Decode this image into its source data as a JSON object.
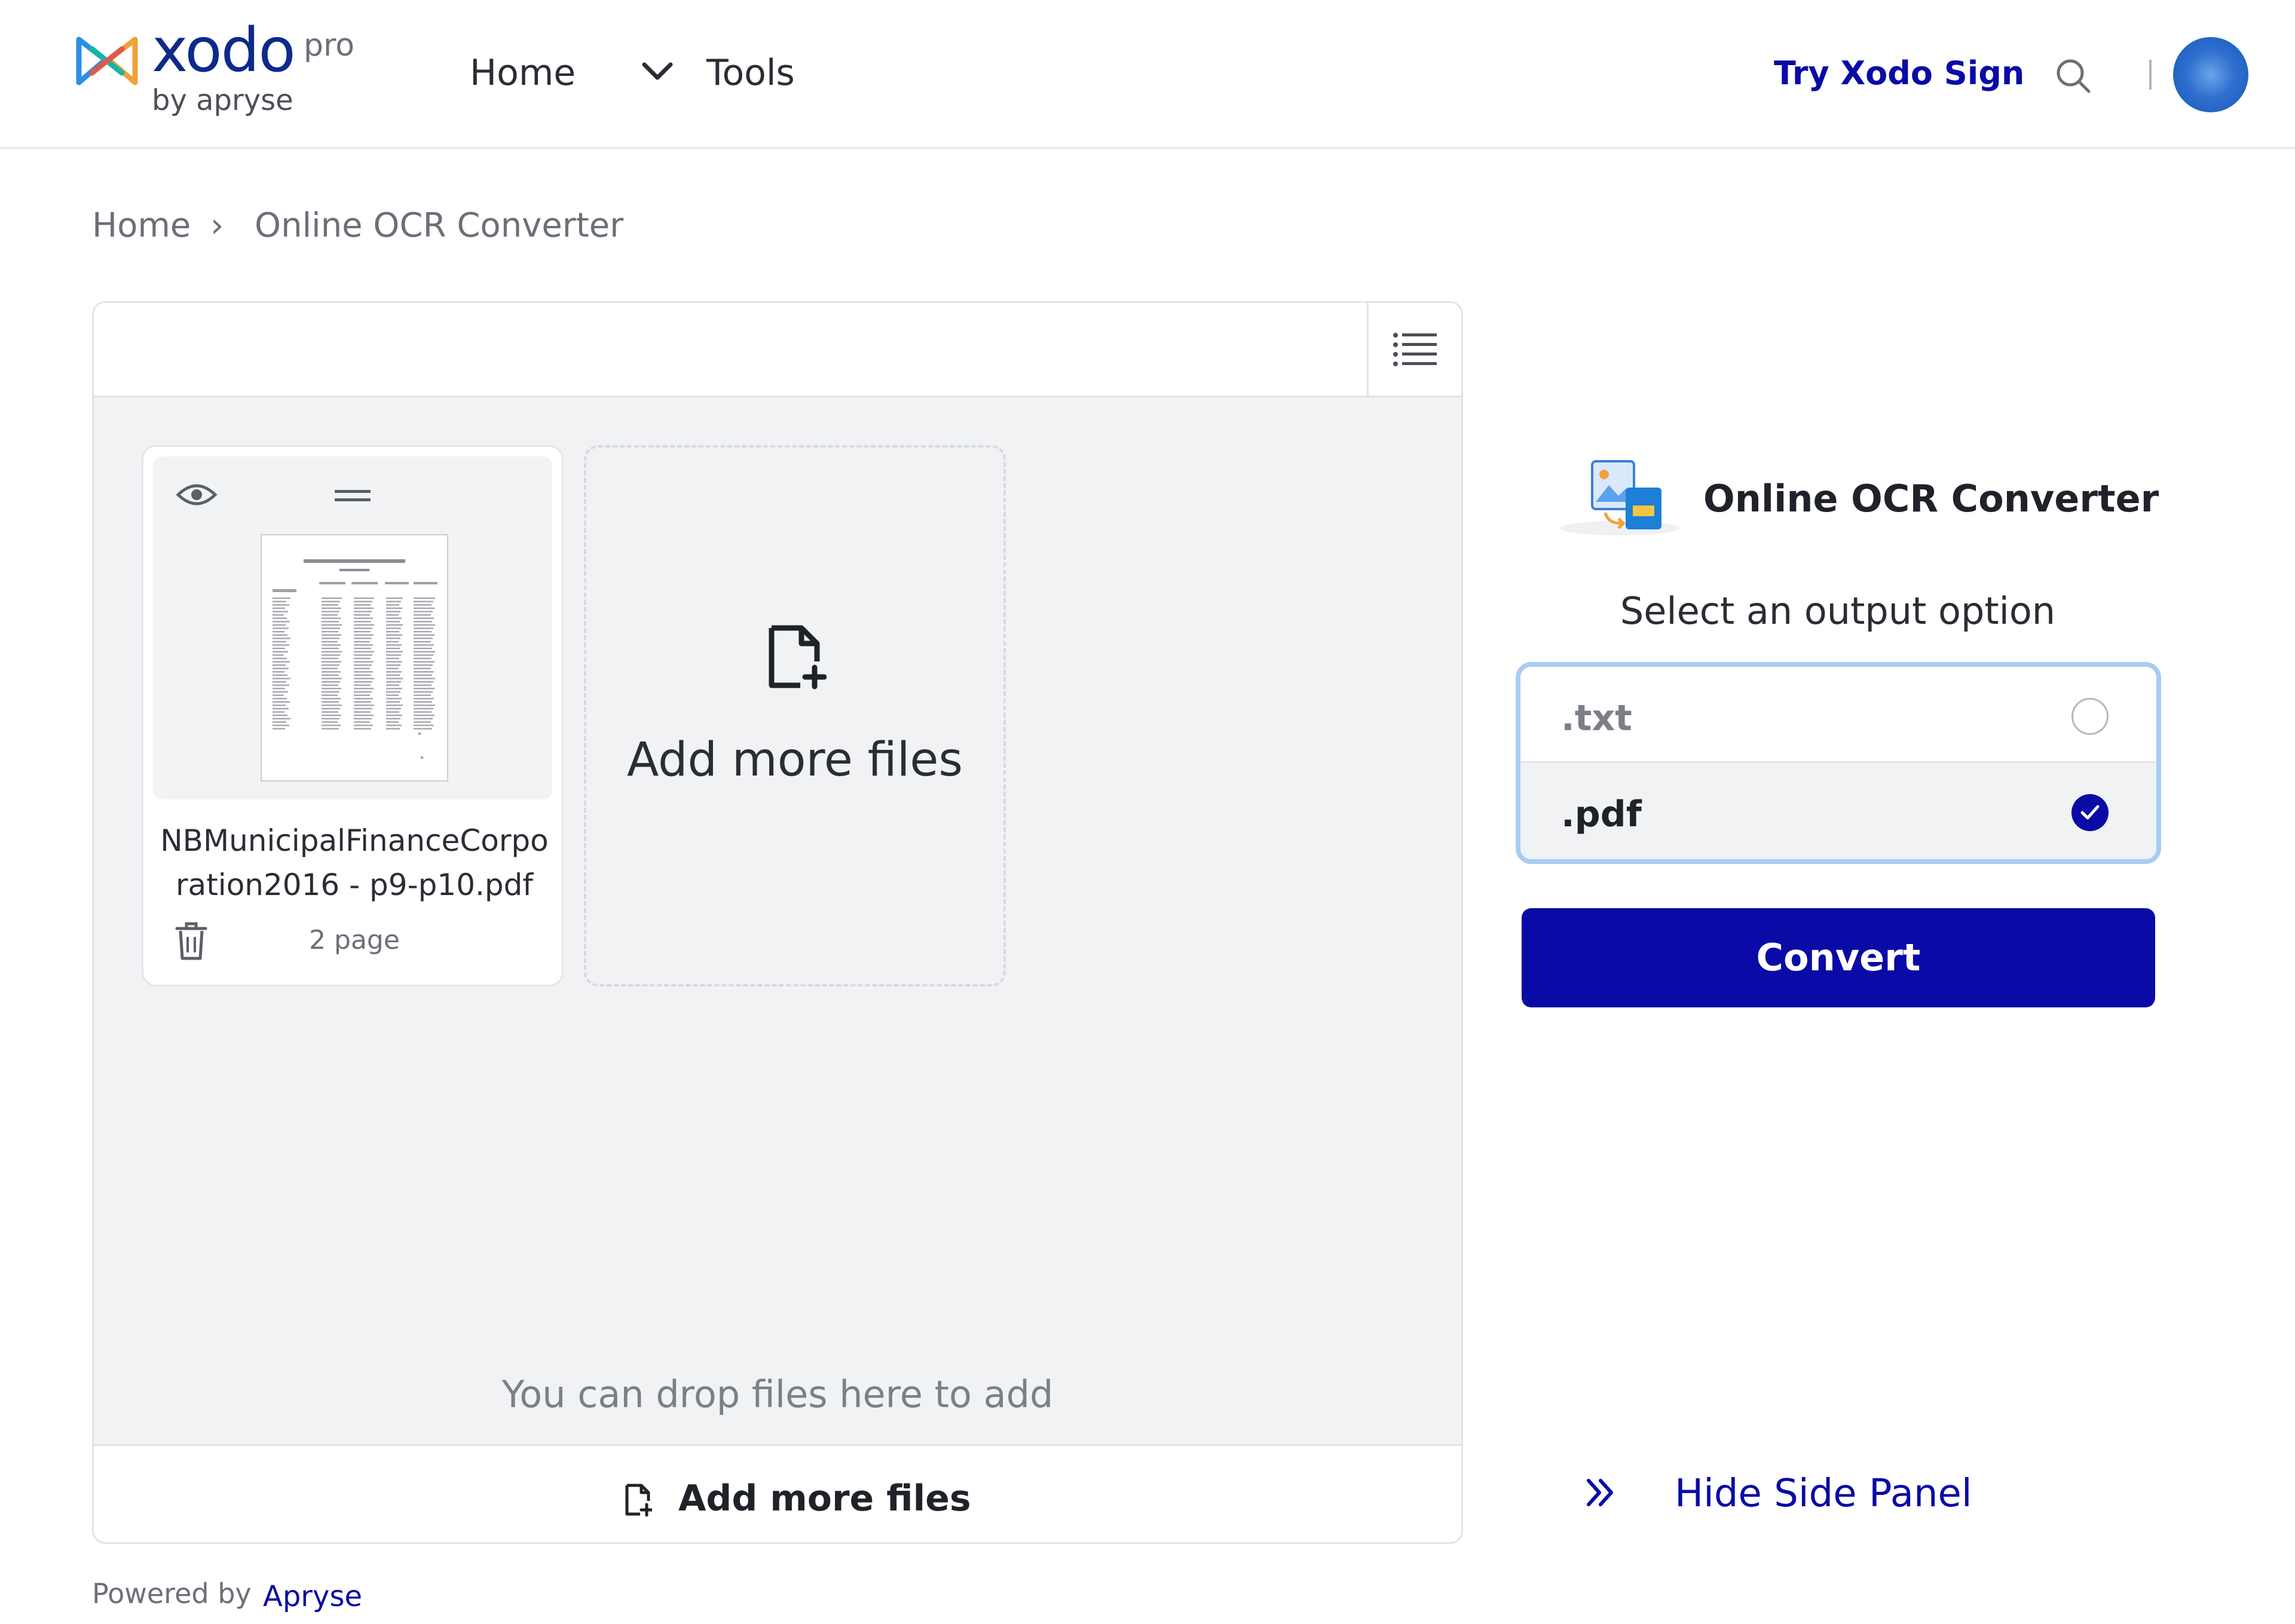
{
  "header": {
    "logo_word": "xodo",
    "logo_pro": "pro",
    "logo_by": "by apryse",
    "nav_home": "Home",
    "nav_tools": "Tools",
    "try_sign": "Try Xodo Sign"
  },
  "breadcrumb": {
    "home": "Home",
    "separator": "›",
    "current": "Online OCR Converter"
  },
  "files": {
    "items": [
      {
        "name": "NBMunicipalFinanceCorporation2016 - p9-p10.pdf",
        "pages": "2 page"
      }
    ],
    "add_tile_label": "Add more files",
    "drop_hint": "You can drop files here to add",
    "bottom_add_label": "Add more files"
  },
  "footer": {
    "powered_by": "Powered by",
    "powered_link": "Apryse"
  },
  "side_panel": {
    "tool_title": "Online OCR Converter",
    "select_label": "Select an output option",
    "options": [
      {
        "label": ".txt",
        "selected": false
      },
      {
        "label": ".pdf",
        "selected": true
      }
    ],
    "convert_label": "Convert",
    "hide_label": "Hide Side Panel"
  },
  "colors": {
    "brand_blue": "#0a0aa6",
    "option_border": "#a8cdf2",
    "panel_bg": "#f1f2f4"
  }
}
